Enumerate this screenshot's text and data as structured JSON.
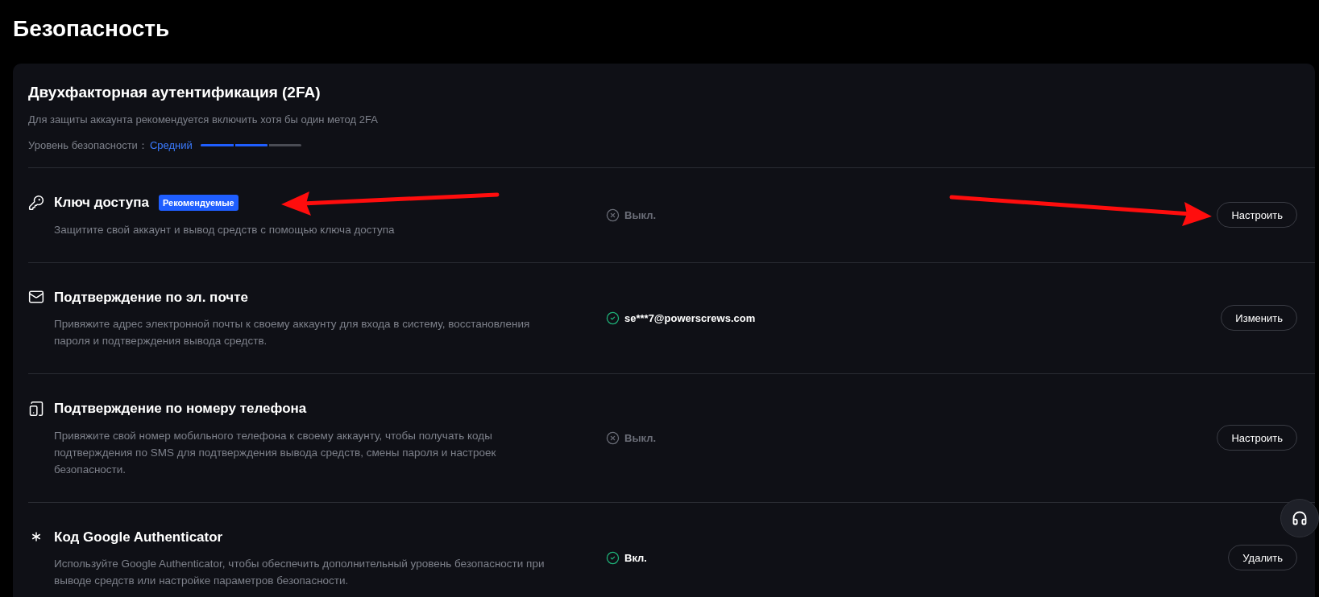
{
  "page_title": "Безопасность",
  "section": {
    "title": "Двухфакторная аутентификация (2FA)",
    "subtitle": "Для защиты аккаунта рекомендуется включить хотя бы один метод 2FA",
    "level_label": "Уровень безопасности：",
    "level_value": "Средний",
    "level": 0.67
  },
  "methods": [
    {
      "kind": "key",
      "title": "Ключ доступа",
      "badge": "Рекомендуемые",
      "description": "Защитите свой аккаунт и вывод средств с помощью ключа доступа",
      "status": {
        "enabled": false,
        "text": "Выкл."
      },
      "button": "Настроить"
    },
    {
      "kind": "mail",
      "title": "Подтверждение по эл. почте",
      "description": "Привяжите адрес электронной почты к своему аккаунту для входа в систему, восстановления пароля и подтверждения вывода средств.",
      "status": {
        "enabled": true,
        "text": "se***7@powerscrews.com"
      },
      "button": "Изменить"
    },
    {
      "kind": "phone",
      "title": "Подтверждение по номеру телефона",
      "description": "Привяжите свой номер мобильного телефона к своему аккаунту, чтобы получать коды подтверждения по SMS для подтверждения вывода средств, смены пароля и настроек безопасности.",
      "status": {
        "enabled": false,
        "text": "Выкл."
      },
      "button": "Настроить"
    },
    {
      "kind": "authenticator",
      "title": "Код Google Authenticator",
      "description": "Используйте Google Authenticator, чтобы обеспечить дополнительный уровень безопасности при выводе средств или настройке параметров безопасности.",
      "status": {
        "enabled": true,
        "text": "Вкл."
      },
      "button": "Удалить"
    }
  ]
}
